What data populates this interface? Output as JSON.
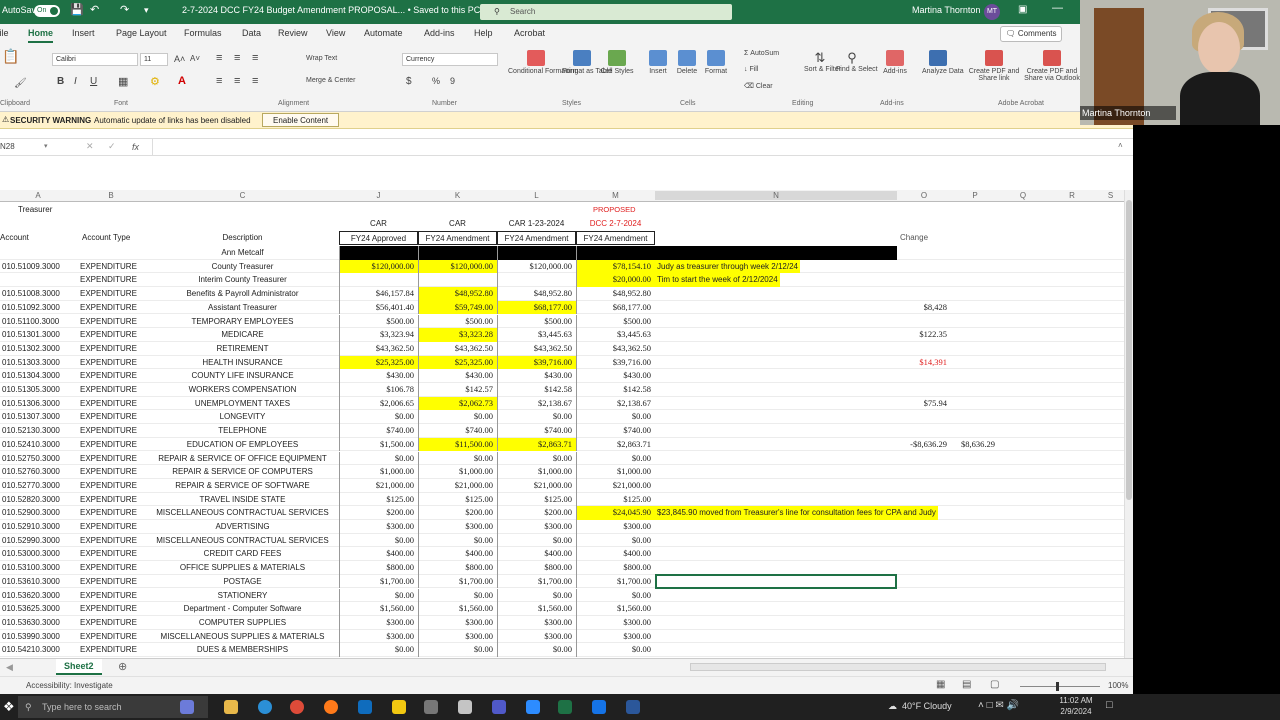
{
  "titlebar": {
    "autosave": "AutoSave",
    "autosave_state": "On",
    "filename": "2-7-2024 DCC FY24 Budget Amendment PROPOSAL... • Saved to this PC",
    "search_placeholder": "Search",
    "user": "Martina Thornton",
    "initials": "MT"
  },
  "menu": {
    "tabs": [
      "File",
      "Home",
      "Insert",
      "Page Layout",
      "Formulas",
      "Data",
      "Review",
      "View",
      "Automate",
      "Add-ins",
      "Help",
      "Acrobat"
    ],
    "comments": "Comments"
  },
  "ribbon": {
    "font": "Calibri",
    "size": "11",
    "wrap": "Wrap Text",
    "merge": "Merge & Center",
    "number_format": "Currency",
    "groups": [
      "Clipboard",
      "Font",
      "Alignment",
      "Number",
      "Styles",
      "Cells",
      "Editing",
      "Add-ins",
      "Adobe Acrobat"
    ],
    "buttons": [
      "Conditional Formatting",
      "Format as Table",
      "Cell Styles",
      "Insert",
      "Delete",
      "Format",
      "AutoSum",
      "Fill",
      "Clear",
      "Sort & Filter",
      "Find & Select",
      "Add-ins",
      "Analyze Data",
      "Create PDF and Share link",
      "Create PDF and Share via Outlook"
    ]
  },
  "security": {
    "label": "SECURITY WARNING",
    "message": "Automatic update of links has been disabled",
    "button": "Enable Content"
  },
  "formula": {
    "namebox": "N28",
    "fx": "fx",
    "value": ""
  },
  "columns": [
    {
      "letter": "A"
    },
    {
      "letter": "B"
    },
    {
      "letter": "C"
    },
    {
      "letter": "J"
    },
    {
      "letter": "K"
    },
    {
      "letter": "L"
    },
    {
      "letter": "M"
    },
    {
      "letter": "N"
    },
    {
      "letter": "O"
    },
    {
      "letter": "P"
    },
    {
      "letter": "Q"
    },
    {
      "letter": "R"
    },
    {
      "letter": "S"
    }
  ],
  "sheet_header": {
    "a_title": "Treasurer",
    "j_top": "CAR",
    "k_top": "CAR",
    "l_top": "CAR 1-23-2024",
    "m_top1": "PROPOSED",
    "m_top2": "DCC 2-7-2024",
    "account": "Account",
    "account_type": "Account Type",
    "description": "Description",
    "j": "FY24 Approved",
    "k": "FY24 Amendment",
    "l": "FY24 Amendment",
    "m": "FY24 Amendment",
    "o": "Change"
  },
  "rows": [
    {
      "a": "",
      "b": "",
      "c": "Ann Metcalf",
      "j": "",
      "k": "",
      "l": "",
      "m": "",
      "n": "",
      "o": "",
      "p": "",
      "bar": true
    },
    {
      "a": "010.51009.3000",
      "b": "EXPENDITURE",
      "c": "County Treasurer",
      "j": "$120,000.00",
      "k": "$120,000.00",
      "l": "$120,000.00",
      "m": "$78,154.10",
      "n": "Judy as treasurer through week 2/12/24",
      "o": "",
      "p": "",
      "yj": true,
      "yk": true,
      "ym": true,
      "yn": true
    },
    {
      "a": "",
      "b": "EXPENDITURE",
      "c": "Interim County Treasurer",
      "j": "",
      "k": "",
      "l": "",
      "m": "$20,000.00",
      "n": "Tim to start the week of 2/12/2024",
      "o": "",
      "p": "",
      "ym": true,
      "yn": true
    },
    {
      "a": "010.51008.3000",
      "b": "EXPENDITURE",
      "c": "Benefits & Payroll Administrator",
      "j": "$46,157.84",
      "k": "$48,952.80",
      "l": "$48,952.80",
      "m": "$48,952.80",
      "n": "",
      "o": "",
      "p": "",
      "yk": true
    },
    {
      "a": "010.51092.3000",
      "b": "EXPENDITURE",
      "c": "Assistant Treasurer",
      "j": "$56,401.40",
      "k": "$59,749.00",
      "l": "$68,177.00",
      "m": "$68,177.00",
      "n": "",
      "o": "$8,428",
      "p": "",
      "yk": true,
      "yl": true
    },
    {
      "a": "010.51100.3000",
      "b": "EXPENDITURE",
      "c": "TEMPORARY EMPLOYEES",
      "j": "$500.00",
      "k": "$500.00",
      "l": "$500.00",
      "m": "$500.00",
      "n": "",
      "o": "",
      "p": ""
    },
    {
      "a": "010.51301.3000",
      "b": "EXPENDITURE",
      "c": "MEDICARE",
      "j": "$3,323.94",
      "k": "$3,323.28",
      "l": "$3,445.63",
      "m": "$3,445.63",
      "n": "",
      "o": "$122.35",
      "p": "",
      "yk": true
    },
    {
      "a": "010.51302.3000",
      "b": "EXPENDITURE",
      "c": "RETIREMENT",
      "j": "$43,362.50",
      "k": "$43,362.50",
      "l": "$43,362.50",
      "m": "$43,362.50",
      "n": "",
      "o": "",
      "p": ""
    },
    {
      "a": "010.51303.3000",
      "b": "EXPENDITURE",
      "c": "HEALTH INSURANCE",
      "j": "$25,325.00",
      "k": "$25,325.00",
      "l": "$39,716.00",
      "m": "$39,716.00",
      "n": "",
      "o": "$14,391",
      "p": "",
      "yj": true,
      "yk": true,
      "yl": true,
      "ored": true
    },
    {
      "a": "010.51304.3000",
      "b": "EXPENDITURE",
      "c": "COUNTY LIFE INSURANCE",
      "j": "$430.00",
      "k": "$430.00",
      "l": "$430.00",
      "m": "$430.00",
      "n": "",
      "o": "",
      "p": ""
    },
    {
      "a": "010.51305.3000",
      "b": "EXPENDITURE",
      "c": "WORKERS COMPENSATION",
      "j": "$106.78",
      "k": "$142.57",
      "l": "$142.58",
      "m": "$142.58",
      "n": "",
      "o": "",
      "p": ""
    },
    {
      "a": "010.51306.3000",
      "b": "EXPENDITURE",
      "c": "UNEMPLOYMENT TAXES",
      "j": "$2,006.65",
      "k": "$2,062.73",
      "l": "$2,138.67",
      "m": "$2,138.67",
      "n": "",
      "o": "$75.94",
      "p": "",
      "yk": true
    },
    {
      "a": "010.51307.3000",
      "b": "EXPENDITURE",
      "c": "LONGEVITY",
      "j": "$0.00",
      "k": "$0.00",
      "l": "$0.00",
      "m": "$0.00",
      "n": "",
      "o": "",
      "p": ""
    },
    {
      "a": "010.52130.3000",
      "b": "EXPENDITURE",
      "c": "TELEPHONE",
      "j": "$740.00",
      "k": "$740.00",
      "l": "$740.00",
      "m": "$740.00",
      "n": "",
      "o": "",
      "p": ""
    },
    {
      "a": "010.52410.3000",
      "b": "EXPENDITURE",
      "c": "EDUCATION OF EMPLOYEES",
      "j": "$1,500.00",
      "k": "$11,500.00",
      "l": "$2,863.71",
      "m": "$2,863.71",
      "n": "",
      "o": "-$8,636.29",
      "p": "$8,636.29",
      "yk": true,
      "yl": true
    },
    {
      "a": "010.52750.3000",
      "b": "EXPENDITURE",
      "c": "REPAIR & SERVICE OF OFFICE EQUIPMENT",
      "j": "$0.00",
      "k": "$0.00",
      "l": "$0.00",
      "m": "$0.00",
      "n": "",
      "o": "",
      "p": ""
    },
    {
      "a": "010.52760.3000",
      "b": "EXPENDITURE",
      "c": "REPAIR & SERVICE OF COMPUTERS",
      "j": "$1,000.00",
      "k": "$1,000.00",
      "l": "$1,000.00",
      "m": "$1,000.00",
      "n": "",
      "o": "",
      "p": ""
    },
    {
      "a": "010.52770.3000",
      "b": "EXPENDITURE",
      "c": "REPAIR & SERVICE OF SOFTWARE",
      "j": "$21,000.00",
      "k": "$21,000.00",
      "l": "$21,000.00",
      "m": "$21,000.00",
      "n": "",
      "o": "",
      "p": ""
    },
    {
      "a": "010.52820.3000",
      "b": "EXPENDITURE",
      "c": "TRAVEL INSIDE STATE",
      "j": "$125.00",
      "k": "$125.00",
      "l": "$125.00",
      "m": "$125.00",
      "n": "",
      "o": "",
      "p": ""
    },
    {
      "a": "010.52900.3000",
      "b": "EXPENDITURE",
      "c": "MISCELLANEOUS CONTRACTUAL SERVICES",
      "j": "$200.00",
      "k": "$200.00",
      "l": "$200.00",
      "m": "$24,045.90",
      "n": "$23,845.90 moved from Treasurer's line for consultation fees for CPA and Judy",
      "o": "",
      "p": "",
      "ym": true,
      "yn": true
    },
    {
      "a": "010.52910.3000",
      "b": "EXPENDITURE",
      "c": "ADVERTISING",
      "j": "$300.00",
      "k": "$300.00",
      "l": "$300.00",
      "m": "$300.00",
      "n": "",
      "o": "",
      "p": ""
    },
    {
      "a": "010.52990.3000",
      "b": "EXPENDITURE",
      "c": "MISCELLANEOUS CONTRACTUAL SERVICES",
      "j": "$0.00",
      "k": "$0.00",
      "l": "$0.00",
      "m": "$0.00",
      "n": "",
      "o": "",
      "p": ""
    },
    {
      "a": "010.53000.3000",
      "b": "EXPENDITURE",
      "c": "CREDIT CARD FEES",
      "j": "$400.00",
      "k": "$400.00",
      "l": "$400.00",
      "m": "$400.00",
      "n": "",
      "o": "",
      "p": ""
    },
    {
      "a": "010.53100.3000",
      "b": "EXPENDITURE",
      "c": "OFFICE SUPPLIES & MATERIALS",
      "j": "$800.00",
      "k": "$800.00",
      "l": "$800.00",
      "m": "$800.00",
      "n": "",
      "o": "",
      "p": ""
    },
    {
      "a": "010.53610.3000",
      "b": "EXPENDITURE",
      "c": "POSTAGE",
      "j": "$1,700.00",
      "k": "$1,700.00",
      "l": "$1,700.00",
      "m": "$1,700.00",
      "n": "",
      "o": "",
      "p": "",
      "sel": true
    },
    {
      "a": "010.53620.3000",
      "b": "EXPENDITURE",
      "c": "STATIONERY",
      "j": "$0.00",
      "k": "$0.00",
      "l": "$0.00",
      "m": "$0.00",
      "n": "",
      "o": "",
      "p": ""
    },
    {
      "a": "010.53625.3000",
      "b": "EXPENDITURE",
      "c": "Department - Computer Software",
      "j": "$1,560.00",
      "k": "$1,560.00",
      "l": "$1,560.00",
      "m": "$1,560.00",
      "n": "",
      "o": "",
      "p": ""
    },
    {
      "a": "010.53630.3000",
      "b": "EXPENDITURE",
      "c": "COMPUTER SUPPLIES",
      "j": "$300.00",
      "k": "$300.00",
      "l": "$300.00",
      "m": "$300.00",
      "n": "",
      "o": "",
      "p": ""
    },
    {
      "a": "010.53990.3000",
      "b": "EXPENDITURE",
      "c": "MISCELLANEOUS SUPPLIES & MATERIALS",
      "j": "$300.00",
      "k": "$300.00",
      "l": "$300.00",
      "m": "$300.00",
      "n": "",
      "o": "",
      "p": ""
    },
    {
      "a": "010.54210.3000",
      "b": "EXPENDITURE",
      "c": "DUES & MEMBERSHIPS",
      "j": "$0.00",
      "k": "$0.00",
      "l": "$0.00",
      "m": "$0.00",
      "n": "",
      "o": "",
      "p": ""
    }
  ],
  "sheet_tab": "Sheet2",
  "status": {
    "accessibility": "Accessibility: Investigate",
    "zoom": "100%"
  },
  "taskbar": {
    "search_placeholder": "Type here to search",
    "weather": "40°F Cloudy",
    "time": "11:02 AM",
    "date": "2/9/2024"
  },
  "video": {
    "name": "Martina Thornton"
  },
  "colors": {
    "excel_green": "#1e7145",
    "highlight_yellow": "#ffff00",
    "red_text": "#e02020"
  }
}
